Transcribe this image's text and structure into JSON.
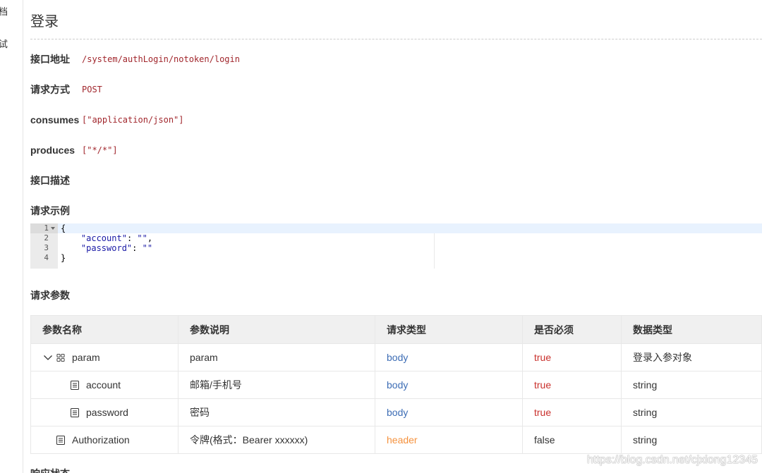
{
  "sidebar": {
    "tabs": [
      {
        "label": "档"
      },
      {
        "label": "试"
      }
    ]
  },
  "api": {
    "title": "登录",
    "fields": [
      {
        "label": "接口地址",
        "value": "/system/authLogin/notoken/login"
      },
      {
        "label": "请求方式",
        "value": "POST"
      },
      {
        "label": "consumes",
        "value": "[\"application/json\"]"
      },
      {
        "label": "produces",
        "value": "[\"*/*\"]"
      },
      {
        "label": "接口描述"
      }
    ],
    "request_example": {
      "label": "请求示例",
      "lines": [
        {
          "number": "1",
          "fold_icon": "caret-down-icon",
          "tokens": [
            {
              "text": "{",
              "color": "#000000"
            }
          ]
        },
        {
          "number": "2",
          "tokens": [
            {
              "text": "    ",
              "color": "#000000"
            },
            {
              "text": "\"account\"",
              "color": "#1a1aa6"
            },
            {
              "text": ": ",
              "color": "#000000"
            },
            {
              "text": "\"\"",
              "color": "#1a1aa6"
            },
            {
              "text": ",",
              "color": "#000000"
            }
          ]
        },
        {
          "number": "3",
          "tokens": [
            {
              "text": "    ",
              "color": "#000000"
            },
            {
              "text": "\"password\"",
              "color": "#1a1aa6"
            },
            {
              "text": ": ",
              "color": "#000000"
            },
            {
              "text": "\"\"",
              "color": "#1a1aa6"
            }
          ]
        },
        {
          "number": "4",
          "tokens": [
            {
              "text": "}",
              "color": "#000000"
            }
          ]
        }
      ]
    },
    "params": {
      "label": "请求参数",
      "columns": [
        "参数名称",
        "参数说明",
        "请求类型",
        "是否必须",
        "数据类型"
      ],
      "rows": [
        {
          "name": "param",
          "level": 0,
          "expand_icon": "chevron-down-icon",
          "icon": "grid-icon",
          "description": "param",
          "in": "body",
          "required": "true",
          "type": "登录入参对象"
        },
        {
          "name": "account",
          "level": 1,
          "icon": "doc-icon",
          "description": "邮箱/手机号",
          "in": "body",
          "required": "true",
          "type": "string"
        },
        {
          "name": "password",
          "level": 1,
          "icon": "doc-icon",
          "description": "密码",
          "in": "body",
          "required": "true",
          "type": "string"
        },
        {
          "name": "Authorization",
          "level": 0,
          "icon": "doc-icon",
          "description": "令牌(格式：Bearer xxxxxx)",
          "in": "header",
          "required": "false",
          "type": "string"
        }
      ]
    },
    "next_section_label": "响应状态"
  },
  "watermark": "https://blog.csdn.net/cjxiong12345",
  "colors": {
    "api_value": "#a1262c",
    "param_in": {
      "body": "#3d6db5",
      "header": "#f5923e"
    },
    "required": {
      "true": "#c9302c",
      "false": "#333333"
    }
  }
}
